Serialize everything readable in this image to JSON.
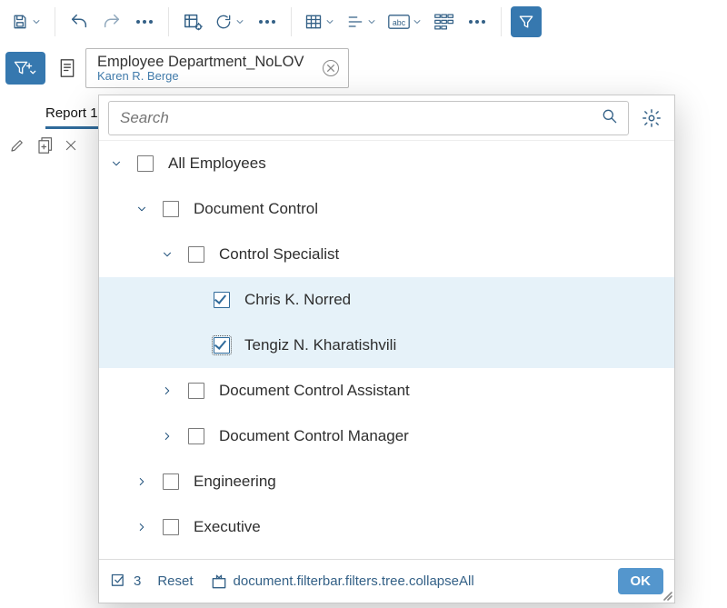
{
  "toolbar": {
    "save_label": "Save",
    "undo_label": "Undo",
    "redo_label": "Redo"
  },
  "filterbar": {
    "chip_title": "Employee Department_NoLOV",
    "chip_sub": "Karen R. Berge"
  },
  "tabs": {
    "active": "Report 1"
  },
  "popover": {
    "search_placeholder": "Search",
    "tree": [
      {
        "id": "all",
        "level": 0,
        "label": "All Employees",
        "expanded": true,
        "checked": false
      },
      {
        "id": "doc",
        "level": 1,
        "label": "Document Control",
        "expanded": true,
        "checked": false
      },
      {
        "id": "cs",
        "level": 2,
        "label": "Control Specialist",
        "expanded": true,
        "checked": false
      },
      {
        "id": "ckn",
        "level": 3,
        "label": "Chris K. Norred",
        "leaf": true,
        "checked": true,
        "selected": true
      },
      {
        "id": "tnk",
        "level": 3,
        "label": "Tengiz N. Kharatishvili",
        "leaf": true,
        "checked": true,
        "selected": true,
        "focus": true
      },
      {
        "id": "dca",
        "level": 2,
        "label": "Document Control Assistant",
        "expanded": false,
        "checked": false
      },
      {
        "id": "dcm",
        "level": 2,
        "label": "Document Control Manager",
        "expanded": false,
        "checked": false
      },
      {
        "id": "eng",
        "level": 1,
        "label": "Engineering",
        "expanded": false,
        "checked": false
      },
      {
        "id": "exe",
        "level": 1,
        "label": "Executive",
        "expanded": false,
        "checked": false
      }
    ],
    "footer": {
      "selected_count": "3",
      "reset_label": "Reset",
      "collapse_label": "document.filterbar.filters.tree.collapseAll",
      "ok_label": "OK"
    }
  }
}
